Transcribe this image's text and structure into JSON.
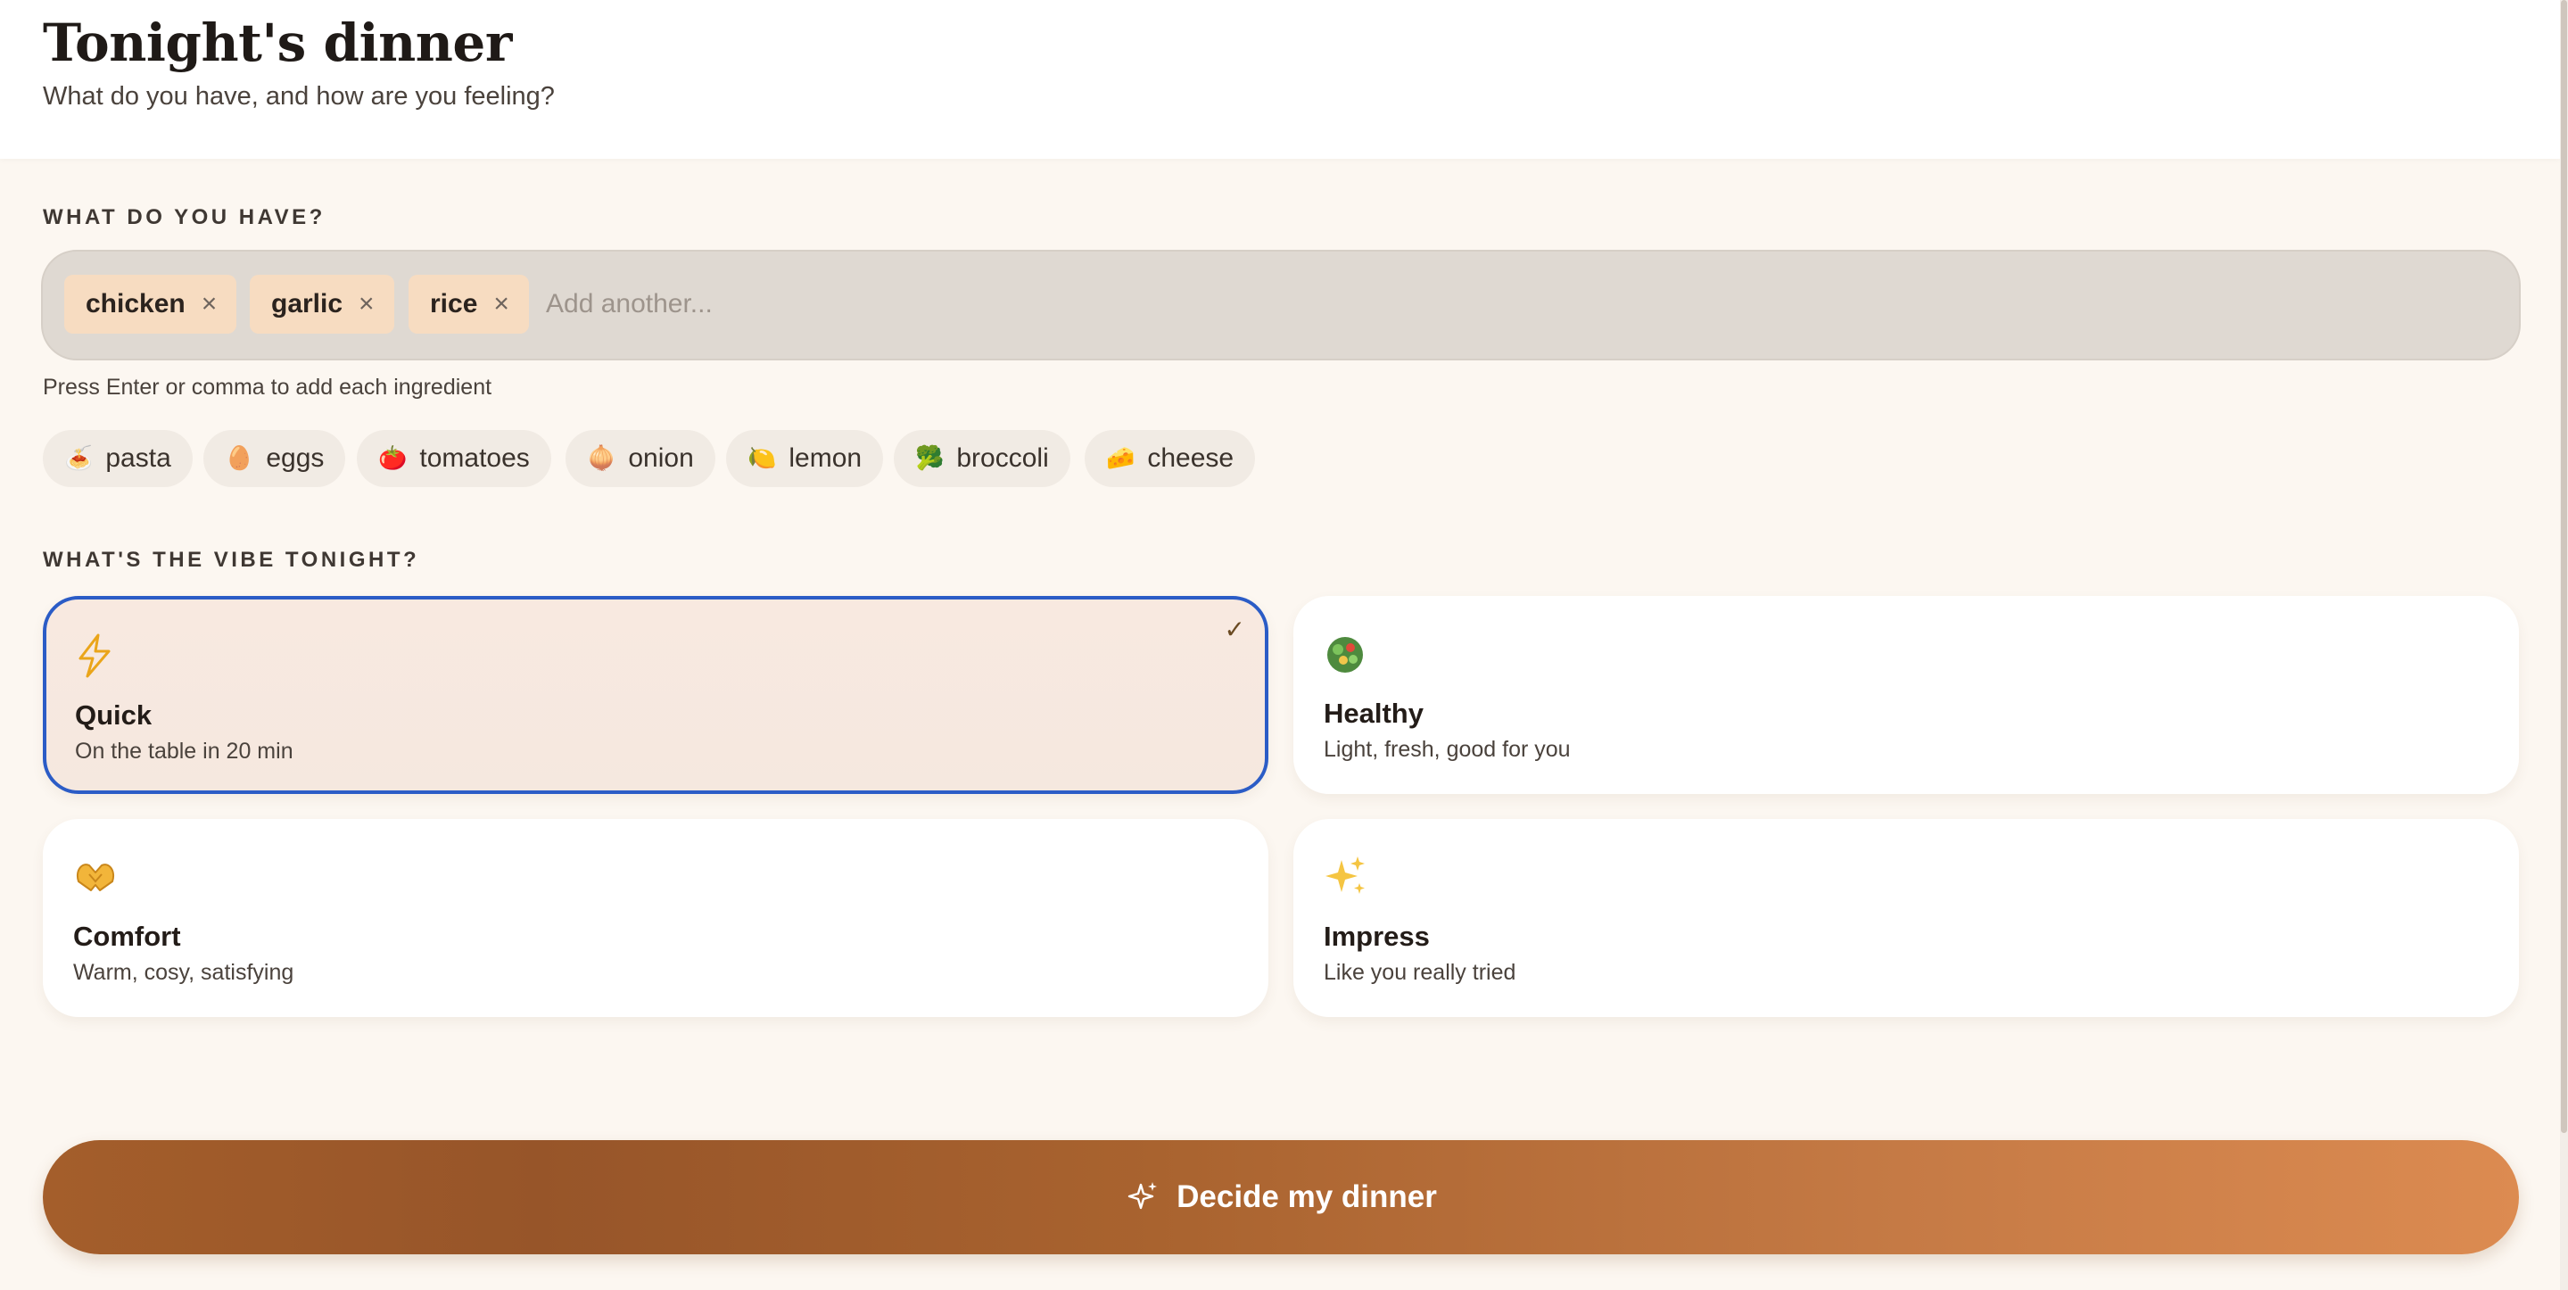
{
  "header": {
    "title": "Tonight's dinner",
    "subtitle": "What do you have, and how are you feeling?"
  },
  "ingredients": {
    "label": "WHAT DO YOU HAVE?",
    "tags": [
      {
        "name": "chicken",
        "remove": "×"
      },
      {
        "name": "garlic",
        "remove": "×"
      },
      {
        "name": "rice",
        "remove": "×"
      }
    ],
    "input_placeholder": "Add another...",
    "hint": "Press Enter or comma to add each ingredient",
    "suggestions": [
      {
        "emoji": "🍝",
        "icon": "pasta-icon",
        "label": "pasta"
      },
      {
        "emoji": "🥚",
        "icon": "egg-icon",
        "label": "eggs"
      },
      {
        "emoji": "🍅",
        "icon": "tomato-icon",
        "label": "tomatoes"
      },
      {
        "emoji": "🧅",
        "icon": "onion-icon",
        "label": "onion"
      },
      {
        "emoji": "🍋",
        "icon": "lemon-icon",
        "label": "lemon"
      },
      {
        "emoji": "🥦",
        "icon": "broccoli-icon",
        "label": "broccoli"
      },
      {
        "emoji": "🧀",
        "icon": "cheese-icon",
        "label": "cheese"
      }
    ]
  },
  "vibe": {
    "label": "WHAT'S THE VIBE TONIGHT?",
    "options": [
      {
        "emoji": "⚡",
        "icon": "lightning-icon",
        "title": "Quick",
        "desc": "On the table in 20 min",
        "selected": true,
        "check": "✓"
      },
      {
        "emoji": "🥗",
        "icon": "salad-icon",
        "title": "Healthy",
        "desc": "Light, fresh, good for you",
        "selected": false
      },
      {
        "emoji": "🫶",
        "icon": "heart-hands-icon",
        "title": "Comfort",
        "desc": "Warm, cosy, satisfying",
        "selected": false
      },
      {
        "emoji": "✨",
        "icon": "sparkles-icon",
        "title": "Impress",
        "desc": "Like you really tried",
        "selected": false
      }
    ]
  },
  "action": {
    "button_label": "Decide my dinner",
    "icon": "sparkle-icon"
  },
  "colors": {
    "accent_selected": "#2b5cc6",
    "tag_bg": "#f7dcc1",
    "button_start": "#a45e2b",
    "button_end": "#dc8b51"
  }
}
